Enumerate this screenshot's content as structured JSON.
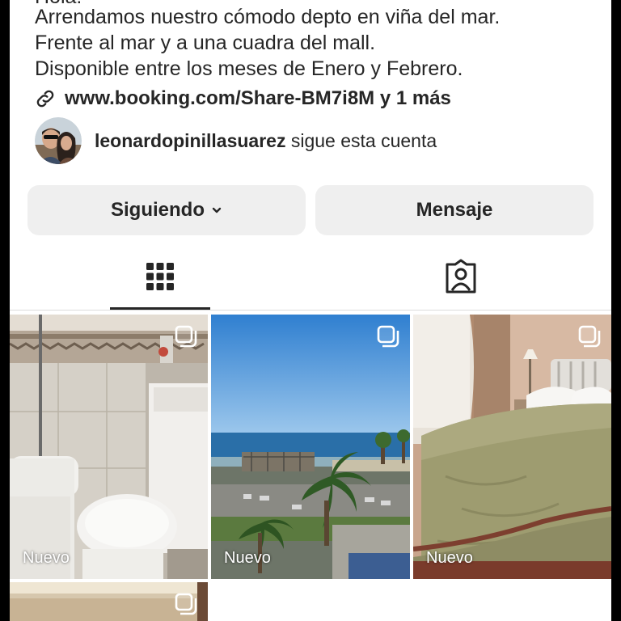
{
  "profile": {
    "bio_cut_line": "Hola!",
    "bio_lines": [
      "Arrendamos nuestro cómodo depto en viña del mar.",
      "Frente al mar y a una cuadra del mall.",
      "Disponible entre los meses de Enero y Febrero."
    ],
    "link_text": "www.booking.com/Share-BM7i8M y 1 más",
    "followed_by_user": "leonardopinillasuarez",
    "followed_by_suffix": " sigue esta cuenta"
  },
  "buttons": {
    "following_label": "Siguiendo",
    "message_label": "Mensaje"
  },
  "tabs": {
    "grid_icon": "grid-icon",
    "tagged_icon": "tagged-person-icon"
  },
  "posts": [
    {
      "badge": "Nuevo",
      "subject": "bathroom",
      "icon": "multi-photo-icon"
    },
    {
      "badge": "Nuevo",
      "subject": "sea-view",
      "icon": "multi-photo-icon"
    },
    {
      "badge": "Nuevo",
      "subject": "bedroom",
      "icon": "multi-photo-icon"
    },
    {
      "badge": "",
      "subject": "interior",
      "icon": "multi-photo-icon"
    }
  ],
  "colors": {
    "text": "#262626",
    "button_bg": "#efefef",
    "divider": "#dbdbdb"
  }
}
